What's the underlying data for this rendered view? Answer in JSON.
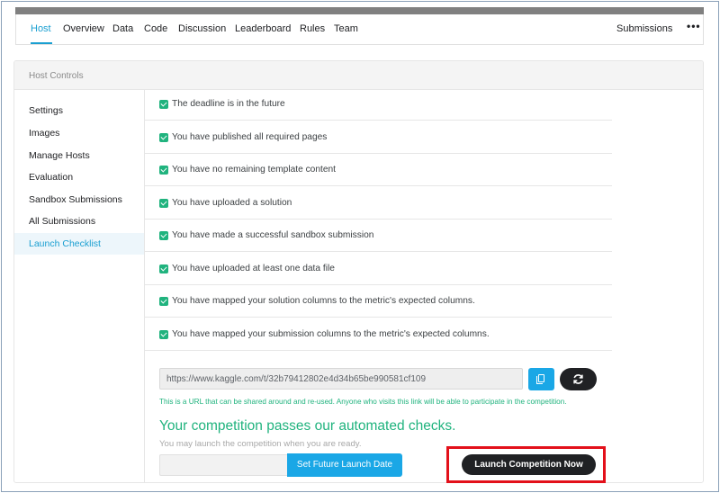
{
  "nav": {
    "tabs": [
      "Host",
      "Overview",
      "Data",
      "Code",
      "Discussion",
      "Leaderboard",
      "Rules",
      "Team"
    ],
    "right_link": "Submissions",
    "more": "•••"
  },
  "panel": {
    "title": "Host Controls"
  },
  "sidebar": {
    "items": [
      "Settings",
      "Images",
      "Manage Hosts",
      "Evaluation",
      "Sandbox Submissions",
      "All Submissions",
      "Launch Checklist"
    ]
  },
  "checklist": [
    "The deadline is in the future",
    "You have published all required pages",
    "You have no remaining template content",
    "You have uploaded a solution",
    "You have made a successful sandbox submission",
    "You have uploaded at least one data file",
    "You have mapped your solution columns to the metric's expected columns.",
    "You have mapped your submission columns to the metric's expected columns."
  ],
  "share": {
    "url": "https://www.kaggle.com/t/32b79412802e4d34b65be990581cf109",
    "note": "This is a URL that can be shared around and re-used. Anyone who visits this link will be able to participate in the competition."
  },
  "launch": {
    "title": "Your competition passes our automated checks.",
    "subtitle": "You may launch the competition when you are ready.",
    "future_button": "Set Future Launch Date",
    "now_button": "Launch Competition Now"
  },
  "colors": {
    "accent": "#1a9fd1",
    "success": "#20b37e",
    "dark": "#202124",
    "highlight": "#e3101a"
  }
}
